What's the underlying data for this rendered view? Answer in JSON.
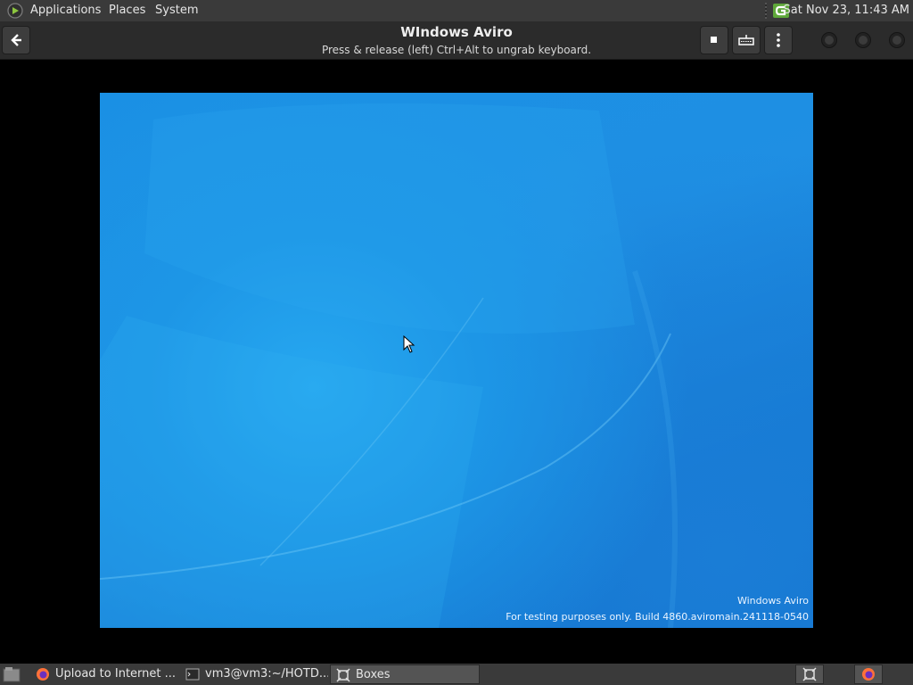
{
  "top_panel": {
    "menus": [
      "Applications",
      "Places",
      "System"
    ],
    "clock": "Sat Nov 23, 11:43 AM"
  },
  "header": {
    "title": "WIndows Aviro",
    "subtitle": "Press & release (left) Ctrl+Alt to ungrab keyboard."
  },
  "vm": {
    "watermark_line1": "Windows Aviro",
    "watermark_line2": "For testing purposes only. Build 4860.aviromain.241118-0540"
  },
  "taskbar": {
    "items": [
      {
        "label": "Upload to Internet ...",
        "icon": "firefox-icon"
      },
      {
        "label": "vm3@vm3:~/HOTD...",
        "icon": "terminal-icon"
      },
      {
        "label": "Boxes",
        "icon": "boxes-icon"
      }
    ]
  },
  "colors": {
    "panel": "#3a3a3a",
    "header": "#2b2b2b",
    "desktop_blue": "#1a8fe3"
  }
}
